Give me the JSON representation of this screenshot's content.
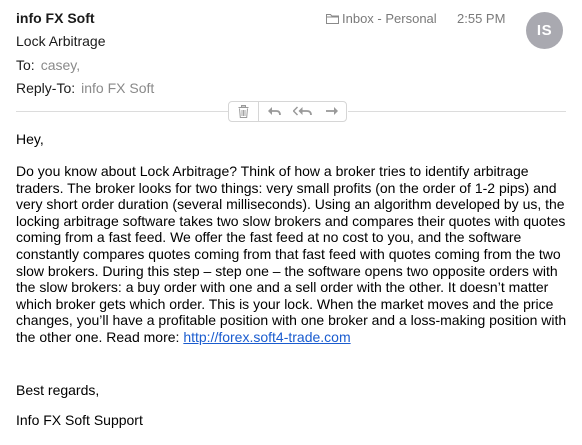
{
  "header": {
    "sender": "info FX Soft",
    "mailbox": "Inbox - Personal",
    "time": "2:55 PM",
    "avatar_initials": "IS",
    "subject": "Lock Arbitrage",
    "to_label": "To:",
    "to_value": "casey,",
    "reply_to_label": "Reply-To:",
    "reply_to_value": "info FX Soft"
  },
  "toolbar": {
    "icons": [
      "trash-icon",
      "reply-icon",
      "reply-all-icon",
      "forward-icon"
    ]
  },
  "message": {
    "greeting": "Hey,",
    "paragraph": "Do you know about Lock Arbitrage? Think of how a broker tries to identify arbitrage traders. The broker looks for two things: very small profits (on the order of 1-2 pips) and very short order duration (several milliseconds). Using an algorithm developed by us, the locking arbitrage software takes two slow brokers and compares their quotes with quotes coming from a fast feed. We offer the fast feed at no cost to you, and the software constantly compares quotes coming from that fast feed with quotes coming from the two slow brokers. During this step – step one – the software opens two opposite orders with the slow brokers: a buy order with one and a sell order with the other. It doesn’t matter which broker gets which order. This is your lock. When the market moves and the price changes, you’ll have a profitable position with one broker and a loss-making position with the other one. Read more: ",
    "link_text": "http://forex.soft4-trade.com",
    "regards": "Best regards,",
    "signature": "Info FX Soft Support"
  },
  "colors": {
    "link": "#1a5ccf",
    "avatar_bg": "#a9a9b0",
    "muted_text": "#7a7a7a"
  }
}
